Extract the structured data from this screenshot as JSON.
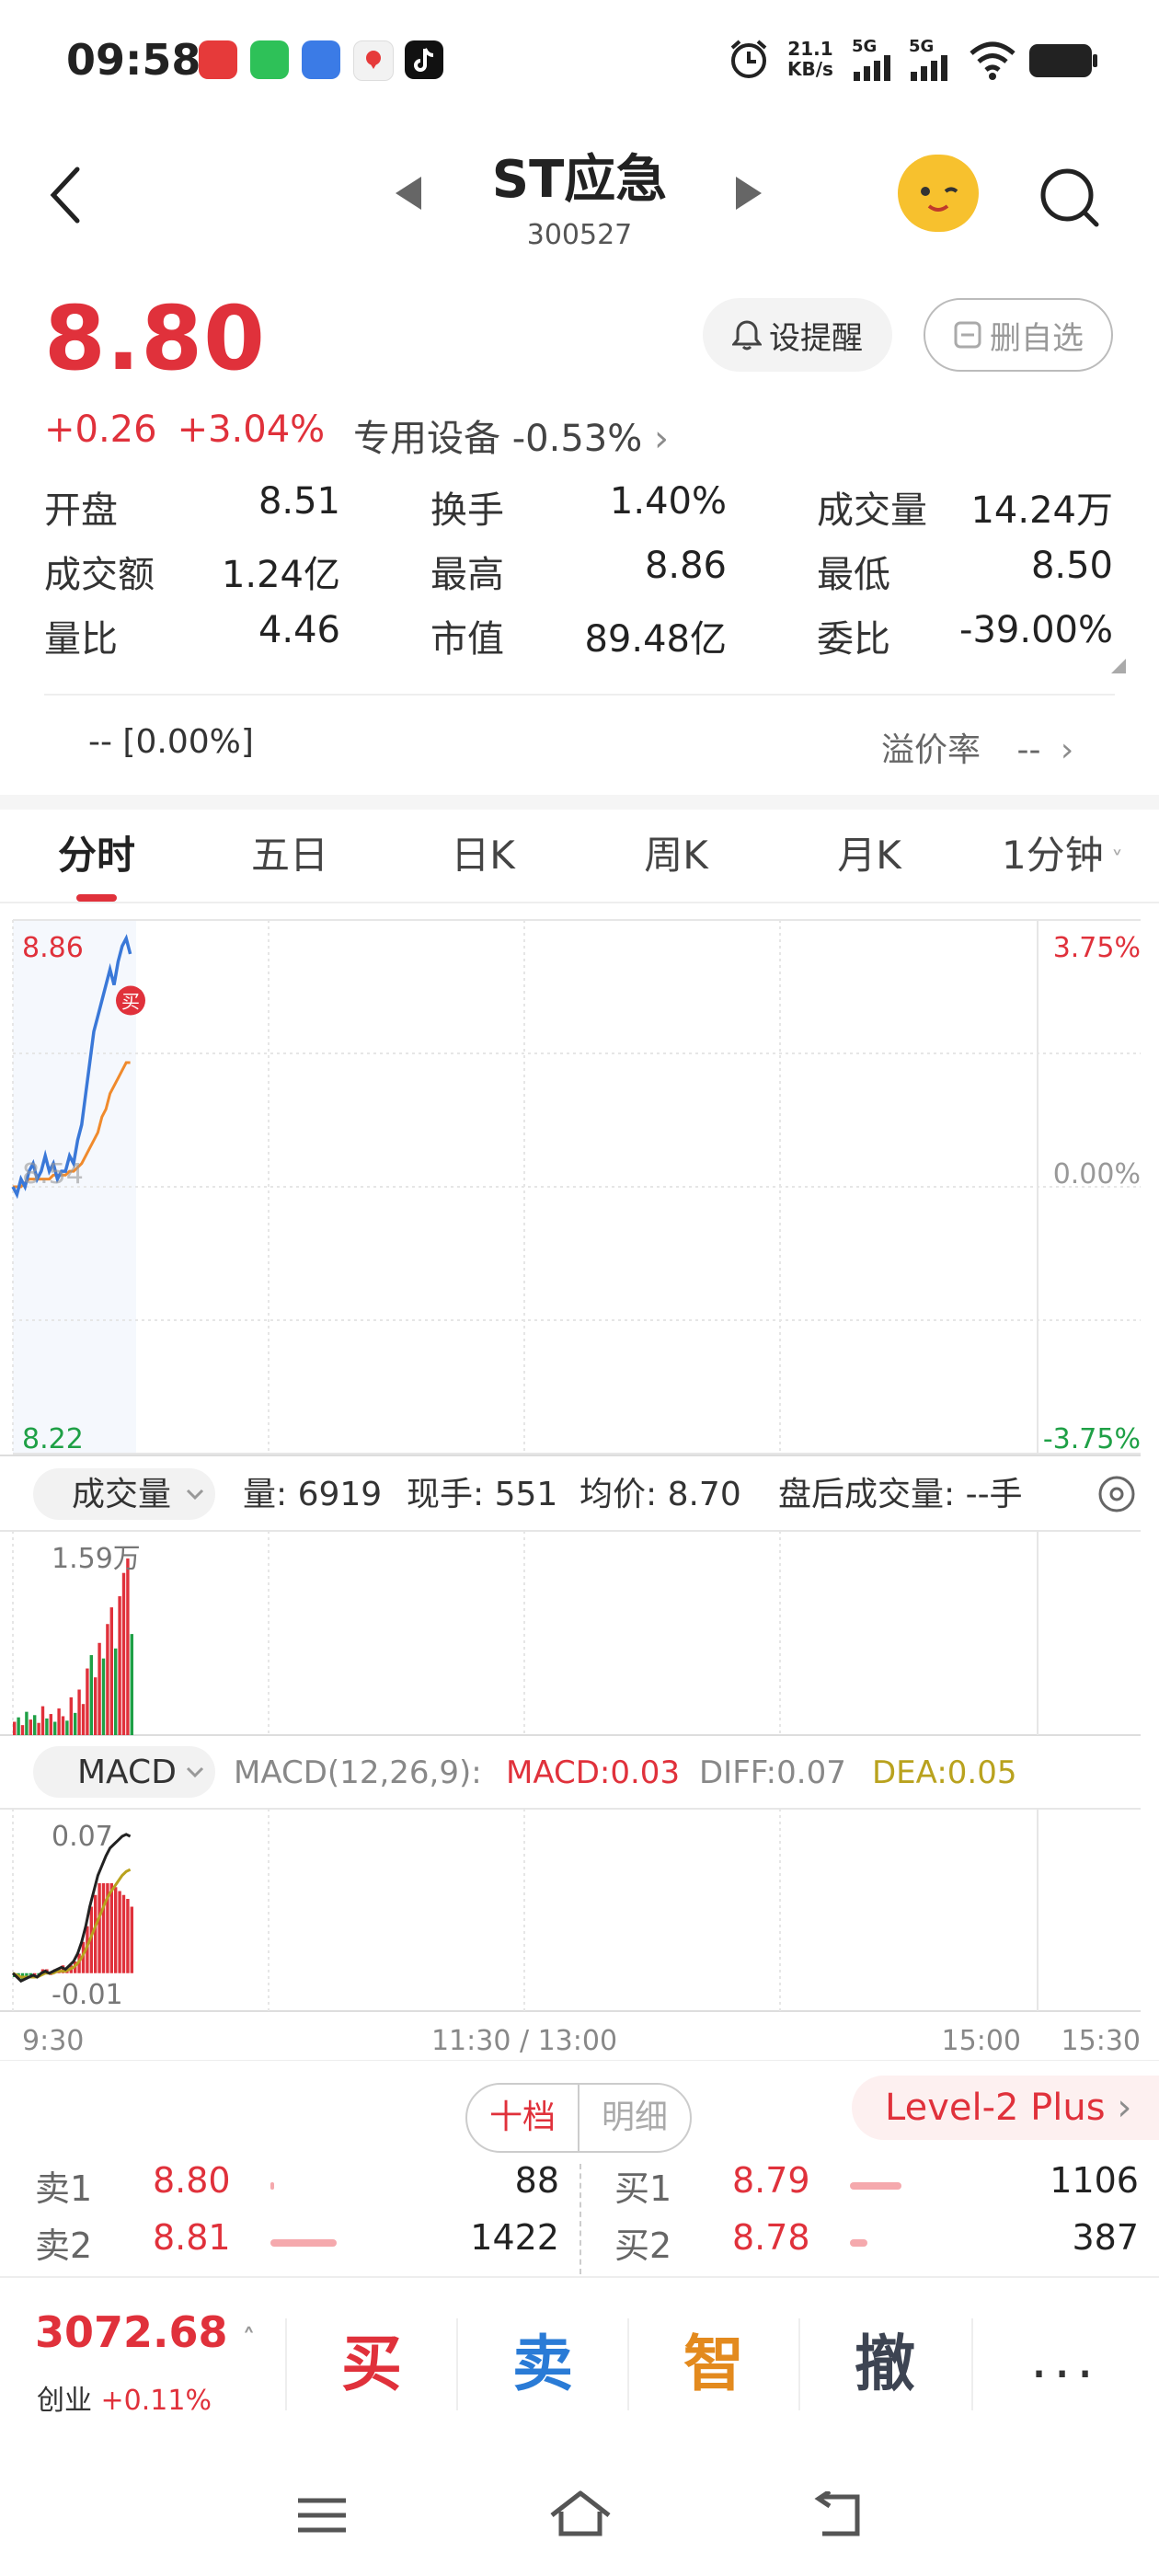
{
  "status_bar": {
    "time": "09:58",
    "net_speed_top": "21.1",
    "net_speed_bottom": "KB/s",
    "signal1": "5G",
    "signal2": "5G",
    "icons": [
      "app-red-icon",
      "wechat-icon",
      "app-blue-icon",
      "map-icon",
      "tiktok-icon",
      "alarm-icon",
      "wifi-icon",
      "battery-icon"
    ]
  },
  "header": {
    "title": "ST应急",
    "code": "300527"
  },
  "quote": {
    "price": "8.80",
    "change": "+0.26",
    "change_pct": "+3.04%",
    "alert_btn": "设提醒",
    "delete_btn": "删自选",
    "sector_name": "专用设备",
    "sector_change": "-0.53%"
  },
  "stats": [
    [
      {
        "label": "开盘",
        "value": "8.51",
        "color": "green"
      },
      {
        "label": "换手",
        "value": "1.40%",
        "color": "normal"
      },
      {
        "label": "成交量",
        "value": "14.24万",
        "color": "normal"
      }
    ],
    [
      {
        "label": "成交额",
        "value": "1.24亿",
        "color": "normal"
      },
      {
        "label": "最高",
        "value": "8.86",
        "color": "red"
      },
      {
        "label": "最低",
        "value": "8.50",
        "color": "green"
      }
    ],
    [
      {
        "label": "量比",
        "value": "4.46",
        "color": "normal"
      },
      {
        "label": "市值",
        "value": "89.48亿",
        "color": "normal"
      },
      {
        "label": "委比",
        "value": "-39.00%",
        "color": "green"
      }
    ]
  ],
  "premium": {
    "left": "-- [0.00%]",
    "label": "溢价率",
    "value": "--"
  },
  "tabs": [
    "分时",
    "五日",
    "日K",
    "周K",
    "月K",
    "1分钟"
  ],
  "chart": {
    "price_top": "8.86",
    "price_mid": "8.54",
    "price_bottom": "8.22",
    "pct_top": "3.75%",
    "pct_mid": "0.00%",
    "pct_bottom": "-3.75%",
    "buy_marker": "买",
    "volume_selector": "成交量",
    "volume_info": {
      "liang": "量: 6919",
      "xianshou": "现手: 551",
      "junjia": "均价: 8.70",
      "panhou": "盘后成交量: --手"
    },
    "volume_max": "1.59万",
    "macd_selector": "MACD",
    "macd_params": "MACD(12,26,9):",
    "macd_val": "MACD:0.03",
    "diff_val": "DIFF:0.07",
    "dea_val": "DEA:0.05",
    "macd_top": "0.07",
    "macd_bottom": "-0.01",
    "time_labels": [
      "9:30",
      "11:30 / 13:00",
      "15:00",
      "15:30"
    ],
    "colors": {
      "price_line": "#3a78d8",
      "avg_line": "#f08a2c",
      "up": "#e0313b",
      "down": "#1fa046",
      "dea": "#b9a21e",
      "diff": "#222222"
    }
  },
  "chart_data": [
    {
      "type": "line",
      "title": "",
      "xlabel": "",
      "ylabel": "",
      "x_ticks": [
        "9:30",
        "11:30 / 13:00",
        "15:00",
        "15:30"
      ],
      "ylim": [
        8.22,
        8.86
      ],
      "series": [
        {
          "values": [
            8.54,
            8.53,
            8.55,
            8.54,
            8.56,
            8.57,
            8.55,
            8.56,
            8.58,
            8.56,
            8.57,
            8.55,
            8.56,
            8.56,
            8.58,
            8.57,
            8.6,
            8.62,
            8.66,
            8.7,
            8.74,
            8.76,
            8.78,
            8.8,
            8.82,
            8.8,
            8.83,
            8.85,
            8.86,
            8.84
          ]
        },
        {
          "values": [
            8.54,
            8.54,
            8.54,
            8.545,
            8.55,
            8.55,
            8.55,
            8.55,
            8.55,
            8.55,
            8.555,
            8.555,
            8.555,
            8.555,
            8.56,
            8.56,
            8.565,
            8.57,
            8.58,
            8.59,
            8.6,
            8.61,
            8.63,
            8.64,
            8.66,
            8.67,
            8.68,
            8.69,
            8.7,
            8.7
          ]
        }
      ]
    },
    {
      "type": "bar",
      "title": "",
      "ylim": [
        0,
        15900
      ],
      "values": [
        1200,
        1600,
        900,
        2100,
        1400,
        1800,
        1100,
        2600,
        1500,
        1900,
        1200,
        2400,
        1700,
        1300,
        3400,
        2000,
        4100,
        2800,
        6000,
        7200,
        5200,
        8300,
        6900,
        10000,
        11500,
        7800,
        12500,
        14600,
        15900,
        9100
      ],
      "colors": [
        "up",
        "down",
        "up",
        "down",
        "up",
        "down",
        "up",
        "up",
        "down",
        "up",
        "down",
        "up",
        "up",
        "down",
        "up",
        "down",
        "up",
        "up",
        "up",
        "down",
        "up",
        "up",
        "down",
        "up",
        "up",
        "down",
        "up",
        "up",
        "up",
        "down"
      ]
    },
    {
      "type": "line",
      "title": "",
      "ylim": [
        -0.01,
        0.07
      ],
      "series": [
        {
          "values": [
            0.0,
            -0.002,
            -0.004,
            -0.003,
            -0.002,
            -0.001,
            -0.002,
            0.0,
            0.001,
            0.0,
            0.001,
            0.002,
            0.003,
            0.002,
            0.004,
            0.006,
            0.01,
            0.016,
            0.024,
            0.034,
            0.042,
            0.05,
            0.055,
            0.06,
            0.064,
            0.066,
            0.068,
            0.07,
            0.071,
            0.07
          ]
        },
        {
          "values": [
            0.0,
            -0.001,
            -0.002,
            -0.002,
            -0.002,
            -0.002,
            -0.002,
            -0.001,
            0.0,
            0.0,
            0.0,
            0.001,
            0.001,
            0.001,
            0.002,
            0.003,
            0.005,
            0.008,
            0.012,
            0.017,
            0.022,
            0.027,
            0.032,
            0.037,
            0.041,
            0.044,
            0.047,
            0.05,
            0.052,
            0.053
          ]
        }
      ],
      "bars": [
        -0.002,
        -0.002,
        -0.004,
        -0.002,
        -0.001,
        0.0,
        -0.001,
        0.002,
        0.002,
        0.0,
        0.002,
        0.002,
        0.004,
        0.002,
        0.004,
        0.006,
        0.01,
        0.016,
        0.024,
        0.034,
        0.04,
        0.046,
        0.046,
        0.046,
        0.046,
        0.044,
        0.042,
        0.04,
        0.038,
        0.034
      ]
    }
  ],
  "orderbook": {
    "seg_on": "十档",
    "seg_off": "明细",
    "level2": "Level-2 Plus",
    "sell": [
      {
        "label": "卖1",
        "price": "8.80",
        "vol": "88",
        "bar": 0.02
      },
      {
        "label": "卖2",
        "price": "8.81",
        "vol": "1422",
        "bar": 0.45
      }
    ],
    "buy": [
      {
        "label": "买1",
        "price": "8.79",
        "vol": "1106",
        "bar": 0.35
      },
      {
        "label": "买2",
        "price": "8.78",
        "vol": "387",
        "bar": 0.12
      }
    ]
  },
  "bottom": {
    "index_value": "3072.68",
    "index_name": "创业",
    "index_change": "+0.11%",
    "actions": [
      {
        "label": "买",
        "color": "#e0313b"
      },
      {
        "label": "卖",
        "color": "#2a7bd6"
      },
      {
        "label": "智",
        "color": "#e38a1e"
      },
      {
        "label": "撤",
        "color": "#3d4452"
      }
    ],
    "more": "···"
  }
}
